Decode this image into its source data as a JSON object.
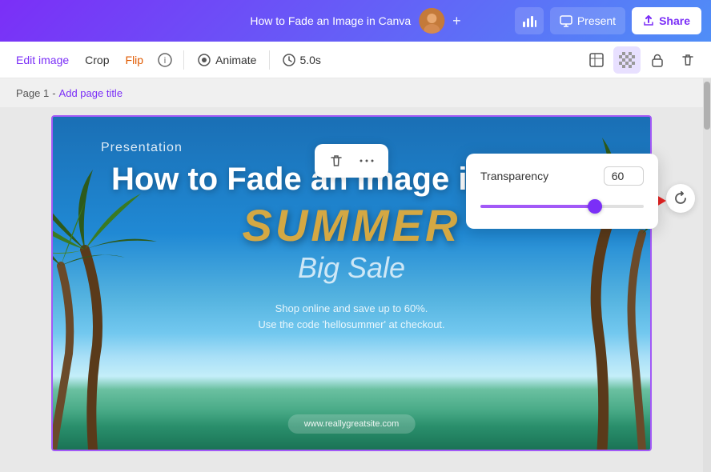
{
  "topNav": {
    "title": "How to Fade an Image in Canva",
    "presentLabel": "Present",
    "shareLabel": "Share",
    "addLabel": "+"
  },
  "toolbar": {
    "editImageLabel": "Edit image",
    "cropLabel": "Crop",
    "flipLabel": "Flip",
    "animateLabel": "Animate",
    "durationLabel": "5.0s"
  },
  "page": {
    "pageLabel": "Page 1",
    "separator": "-",
    "addPageTitle": "Add page title"
  },
  "slide": {
    "presentationLabel": "Presentation",
    "mainTitle": "How to Fade an Image in Canva",
    "summerLabel": "SUMMER",
    "bigSaleLabel": "Big Sale",
    "subtext1": "Shop online and save up to 60%.",
    "subtext2": "Use the code 'hellosummer' at checkout.",
    "websiteLabel": "www.reallygreatsite.com"
  },
  "transparency": {
    "label": "Transparency",
    "value": "60",
    "sliderPercent": 70
  },
  "floatToolbar": {
    "deleteIcon": "🗑",
    "moreIcon": "···"
  },
  "icons": {
    "present": "▶",
    "share": "↑",
    "chart": "📊",
    "info": "ⓘ",
    "animate": "◎",
    "clock": "⏱",
    "mask": "⊡",
    "checker": "▦",
    "lock": "🔒",
    "trash": "🗑",
    "refresh": "↻",
    "chevronDown": "▾"
  }
}
